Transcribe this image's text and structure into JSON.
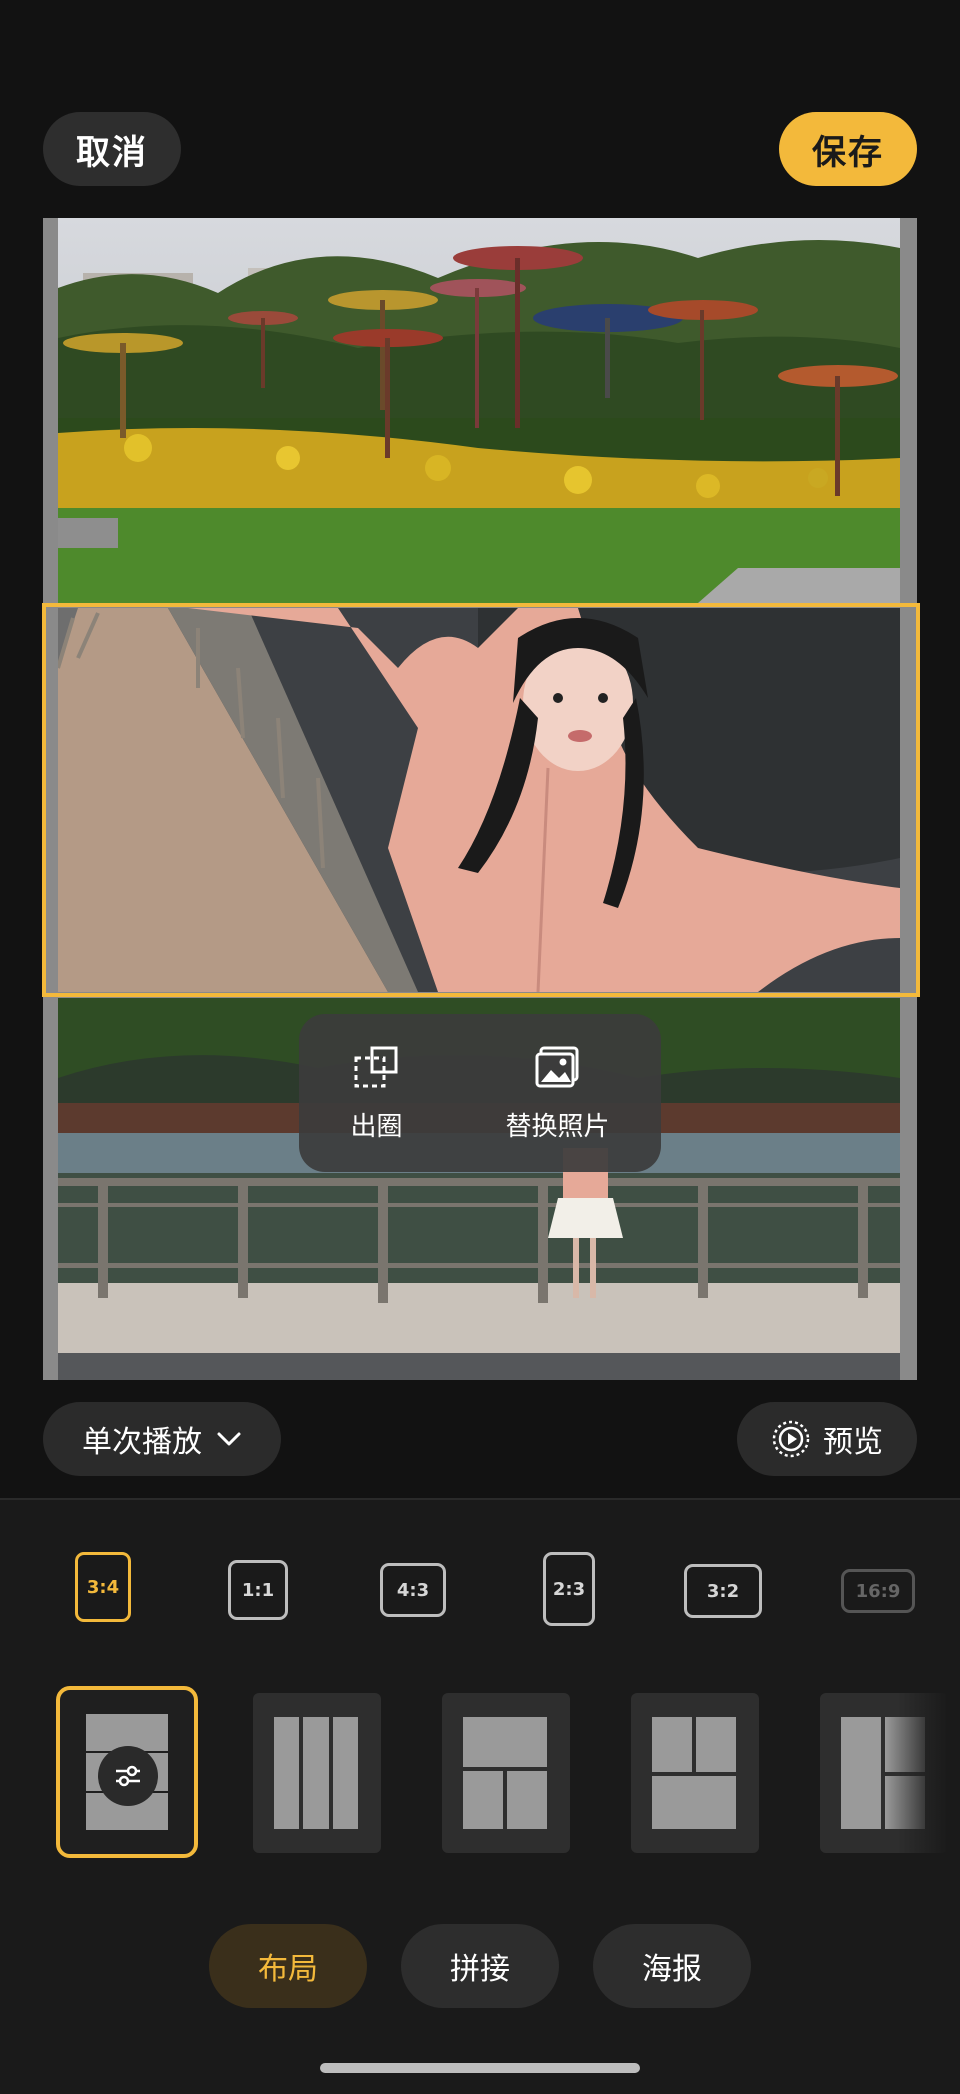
{
  "header": {
    "cancel_label": "取消",
    "save_label": "保存"
  },
  "popup": {
    "cutout_label": "出圈",
    "replace_label": "替换照片"
  },
  "play_mode": {
    "label": "单次播放"
  },
  "preview": {
    "label": "预览"
  },
  "aspect_ratios": [
    {
      "label": "3:4",
      "active": true
    },
    {
      "label": "1:1",
      "active": false
    },
    {
      "label": "4:3",
      "active": false
    },
    {
      "label": "2:3",
      "active": false
    },
    {
      "label": "3:2",
      "active": false
    },
    {
      "label": "16:9",
      "active": false
    }
  ],
  "bottom_tabs": [
    {
      "label": "布局",
      "active": true
    },
    {
      "label": "拼接",
      "active": false
    },
    {
      "label": "海报",
      "active": false
    }
  ],
  "colors": {
    "accent": "#f3b93b",
    "background": "#121212",
    "panel": "#1a1a1a"
  },
  "icons": [
    "cutout-icon",
    "replace-photo-icon",
    "chevron-down-icon",
    "play-circle-icon",
    "adjust-sliders-icon"
  ]
}
